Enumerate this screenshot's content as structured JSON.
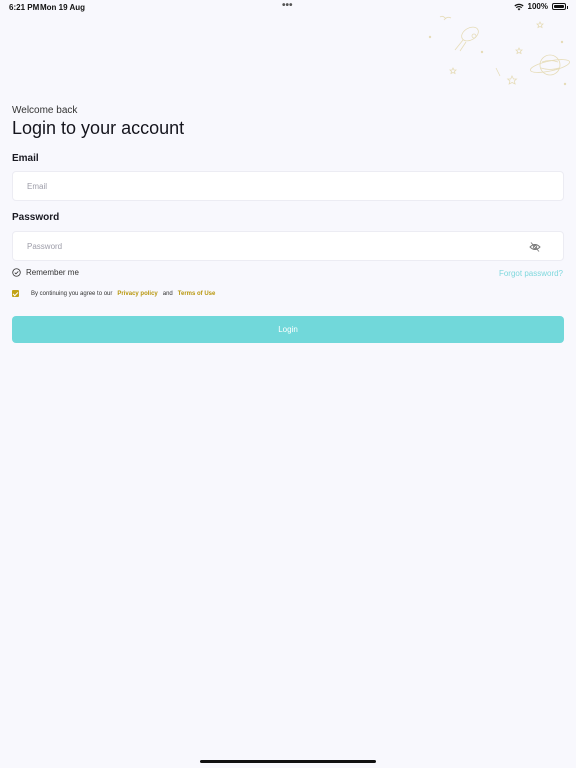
{
  "status_bar": {
    "time": "6:21 PM",
    "date": "Mon 19 Aug",
    "dots": "•••",
    "battery": "100%"
  },
  "header": {
    "welcome": "Welcome back",
    "title": "Login to your account"
  },
  "form": {
    "email_label": "Email",
    "email_placeholder": "Email",
    "password_label": "Password",
    "password_placeholder": "Password",
    "remember_label": "Remember me",
    "forgot_link": "Forgot password?",
    "terms_prefix": "By continuing you agree to our",
    "privacy_link": "Privacy policy",
    "terms_and": "and",
    "terms_link": "Terms of Use",
    "login_button": "Login"
  },
  "icons": {
    "wifi": "wifi-icon",
    "battery": "battery-icon",
    "eye_off": "eye-off-icon",
    "check_circle": "check-circle-icon",
    "checkbox": "checkbox-checked-icon"
  },
  "colors": {
    "background": "#f8f8fd",
    "accent": "#71d8da",
    "link": "#7fd8dd",
    "gold": "#b8960c"
  }
}
